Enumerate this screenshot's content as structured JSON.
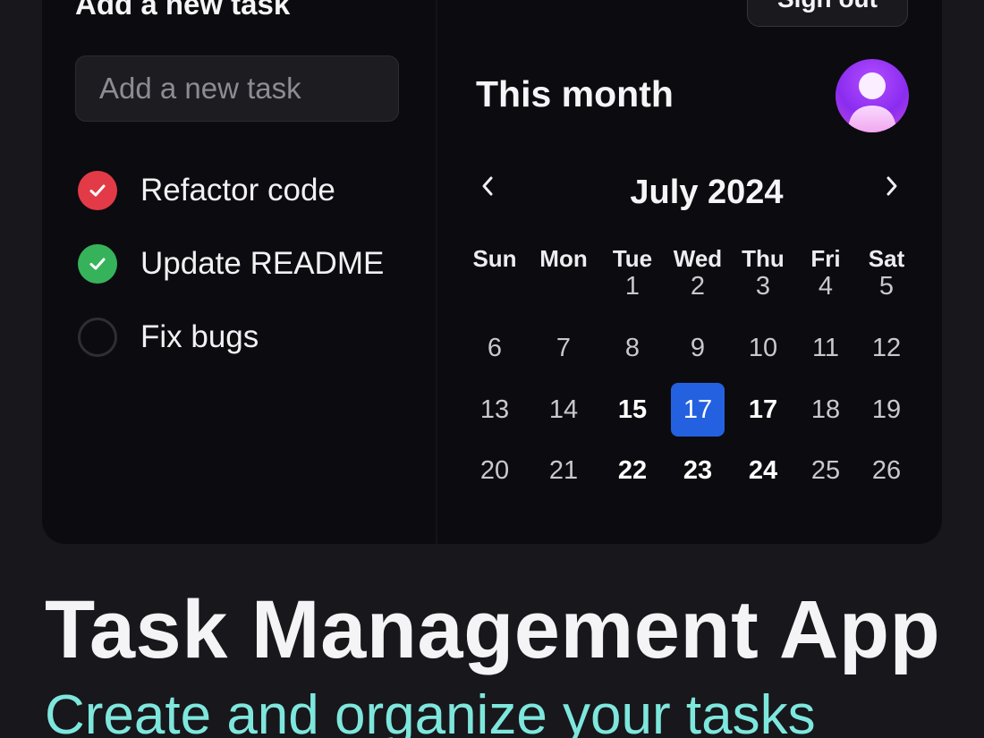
{
  "tasks_panel": {
    "title": "Add a new task",
    "input_placeholder": "Add a new task",
    "items": [
      {
        "label": "Refactor code",
        "status": "done",
        "color": "#e23a47"
      },
      {
        "label": "Update README",
        "status": "done",
        "color": "#36b35a"
      },
      {
        "label": "Fix bugs",
        "status": "pending"
      }
    ]
  },
  "header": {
    "signout_label": "Sign out"
  },
  "calendar": {
    "section_title": "This month",
    "month_label": "July 2024",
    "weekdays": [
      "Sun",
      "Mon",
      "Tue",
      "Wed",
      "Thu",
      "Fri",
      "Sat"
    ],
    "weeks": [
      [
        "",
        "",
        "1",
        "2",
        "3",
        "4",
        "5"
      ],
      [
        "6",
        "7",
        "8",
        "9",
        "10",
        "11",
        "12"
      ],
      [
        "13",
        "14",
        "15",
        "17",
        "17",
        "18",
        "19"
      ],
      [
        "20",
        "21",
        "22",
        "23",
        "24",
        "25",
        "26"
      ]
    ],
    "selected_day": "17",
    "highlighted_days": [
      "15",
      "17",
      "22",
      "23",
      "24"
    ],
    "accent_color": "#2461e0"
  },
  "hero": {
    "title": "Task Management App",
    "subtitle": "Create and organize your tasks",
    "subtitle_color": "#7ee7dd"
  }
}
